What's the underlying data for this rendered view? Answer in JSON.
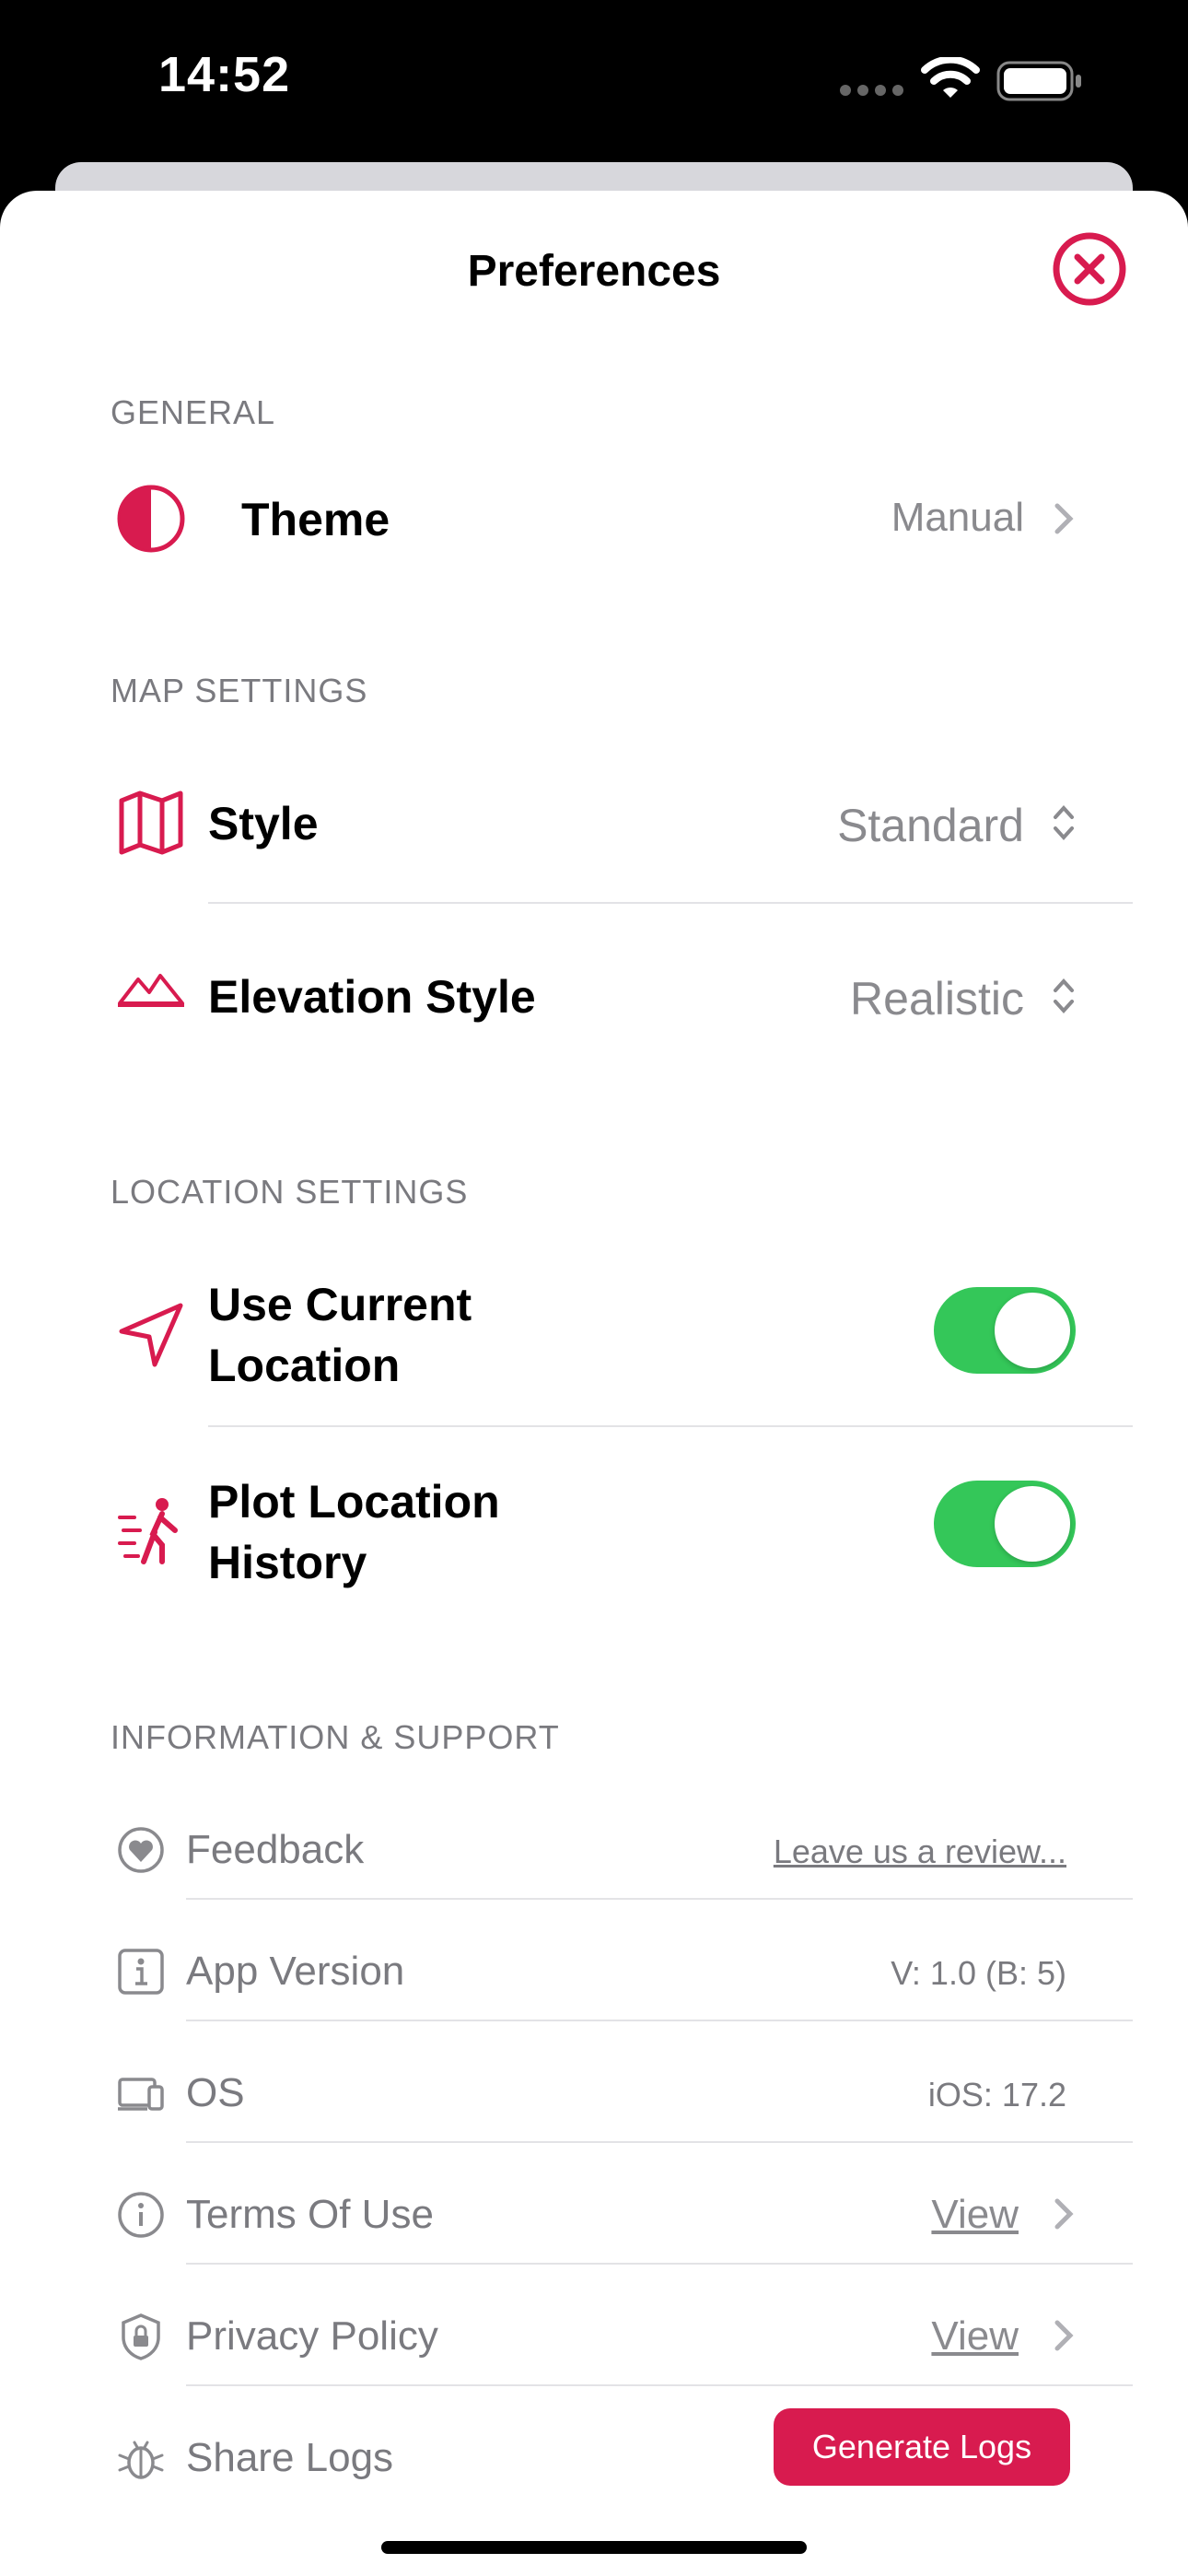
{
  "status_bar": {
    "time": "14:52"
  },
  "sheet": {
    "title": "Preferences"
  },
  "general": {
    "header": "GENERAL",
    "theme": {
      "label": "Theme",
      "value": "Manual"
    }
  },
  "map_settings": {
    "header": "MAP SETTINGS",
    "style": {
      "label": "Style",
      "value": "Standard"
    },
    "elevation": {
      "label": "Elevation Style",
      "value": "Realistic"
    }
  },
  "location_settings": {
    "header": "LOCATION SETTINGS",
    "use_current": {
      "label_line1": "Use Current",
      "label_line2": "Location",
      "on": true
    },
    "plot_history": {
      "label_line1": "Plot Location",
      "label_line2": "History",
      "on": true
    }
  },
  "info_support": {
    "header": "INFORMATION & SUPPORT",
    "feedback": {
      "label": "Feedback",
      "value": "Leave us a review..."
    },
    "app_version": {
      "label": "App Version",
      "value": "V: 1.0 (B: 5)"
    },
    "os": {
      "label": "OS",
      "value": "iOS: 17.2"
    },
    "terms": {
      "label": "Terms Of Use",
      "value": "View"
    },
    "privacy": {
      "label": "Privacy Policy",
      "value": "View"
    },
    "share_logs": {
      "label": "Share Logs",
      "button": "Generate Logs"
    }
  },
  "colors": {
    "accent": "#D81B4F",
    "toggle_on": "#34C759",
    "secondary_text": "#8A8A8E"
  }
}
